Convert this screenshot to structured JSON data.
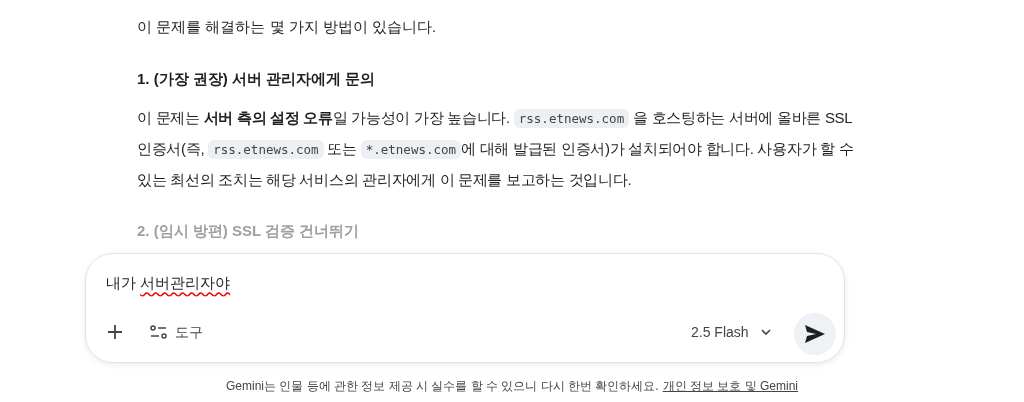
{
  "response": {
    "intro": "이 문제를 해결하는 몇 가지 방법이 있습니다.",
    "sections": [
      {
        "heading": "1. (가장 권장) 서버 관리자에게 문의",
        "faded": false,
        "paragraph": [
          {
            "kind": "text",
            "text": "이 문제는 **서버 측의 설정 오류**일 가능성이 가장 높습니다. "
          },
          {
            "kind": "code",
            "text": "rss.etnews.com"
          },
          {
            "kind": "text",
            "text": " 을 호스팅하는 서버에 올바른 SSL 인증서(즉, "
          },
          {
            "kind": "code",
            "text": "rss.etnews.com"
          },
          {
            "kind": "text",
            "text": " 또는 "
          },
          {
            "kind": "code",
            "text": "*.etnews.com"
          },
          {
            "kind": "text",
            "text": "에 대해 발급된 인증서)가 설치되어야 합니다. 사용자가 할 수 있는 최선의 조치는 해당 서비스의 관리자에게 이 문제를 보고하는 것입니다."
          }
        ]
      },
      {
        "heading": "2. (임시 방편) SSL 검증 건너뛰기",
        "faded": true
      }
    ]
  },
  "composer": {
    "value": [
      {
        "text": "내가 ",
        "misspelled": false
      },
      {
        "text": "서버관리자야",
        "misspelled": true
      }
    ],
    "tools_label": "도구",
    "model": "2.5 Flash"
  },
  "footer": {
    "disclaimer": "Gemini는 인물 등에 관한 정보 제공 시 실수를 할 수 있으니 다시 한번 확인하세요.",
    "link": "개인 정보 보호 및 Gemini"
  }
}
